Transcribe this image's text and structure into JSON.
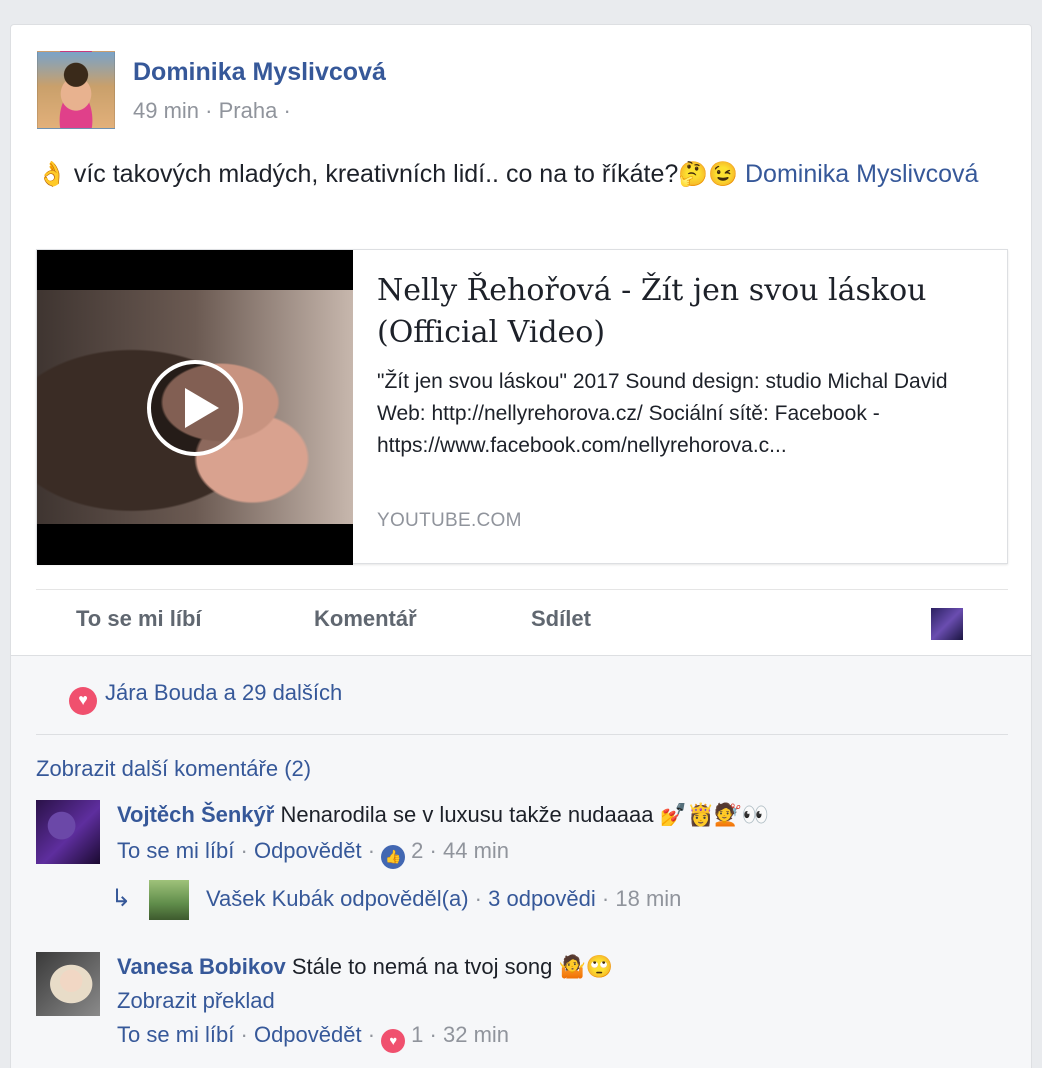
{
  "post": {
    "author": "Dominika Myslivcová",
    "time": "49 min",
    "location": "Praha",
    "separator": "·",
    "text_emoji_start": "👌",
    "text": " víc takových mladých, kreativních lidí.. co na to říkáte?",
    "text_emoji_end": "🤔😉",
    "mention": "Dominika Myslivcová"
  },
  "link_preview": {
    "title": "Nelly Řehořová - Žít jen svou láskou (Official Video)",
    "description": "\"Žít jen svou láskou\" 2017 Sound design: studio Michal David Web: http://nellyrehorova.cz/ Sociální sítě: Facebook - https://www.facebook.com/nellyrehorova.c...",
    "domain": "YOUTUBE.COM",
    "play_icon": "play-icon"
  },
  "actions": {
    "like": "To se mi líbí",
    "comment": "Komentář",
    "share": "Sdílet"
  },
  "reactions": {
    "summary": "Jára Bouda a 29 dalších",
    "icon": "heart-icon"
  },
  "comments": {
    "more": "Zobrazit další komentáře (2)",
    "items": [
      {
        "author": "Vojtěch Šenkýř",
        "text": "Nenarodila se v luxusu takže nudaaaa",
        "emojis": "💅👸💇👀",
        "like": "To se mi líbí",
        "reply": "Odpovědět",
        "reaction_icon": "thumbs-up-icon",
        "reaction_count": "2",
        "time": "44 min",
        "replies": {
          "text": "Vašek Kubák odpověděl(a)",
          "count": "3 odpovědi",
          "time": "18 min"
        }
      },
      {
        "author": "Vanesa Bobikov",
        "text": "Stále to nemá na tvoj song",
        "emojis": "🤷🙄",
        "translate": "Zobrazit překlad",
        "like": "To se mi líbí",
        "reply": "Odpovědět",
        "reaction_icon": "heart-icon",
        "reaction_count": "1",
        "time": "32 min"
      }
    ]
  }
}
